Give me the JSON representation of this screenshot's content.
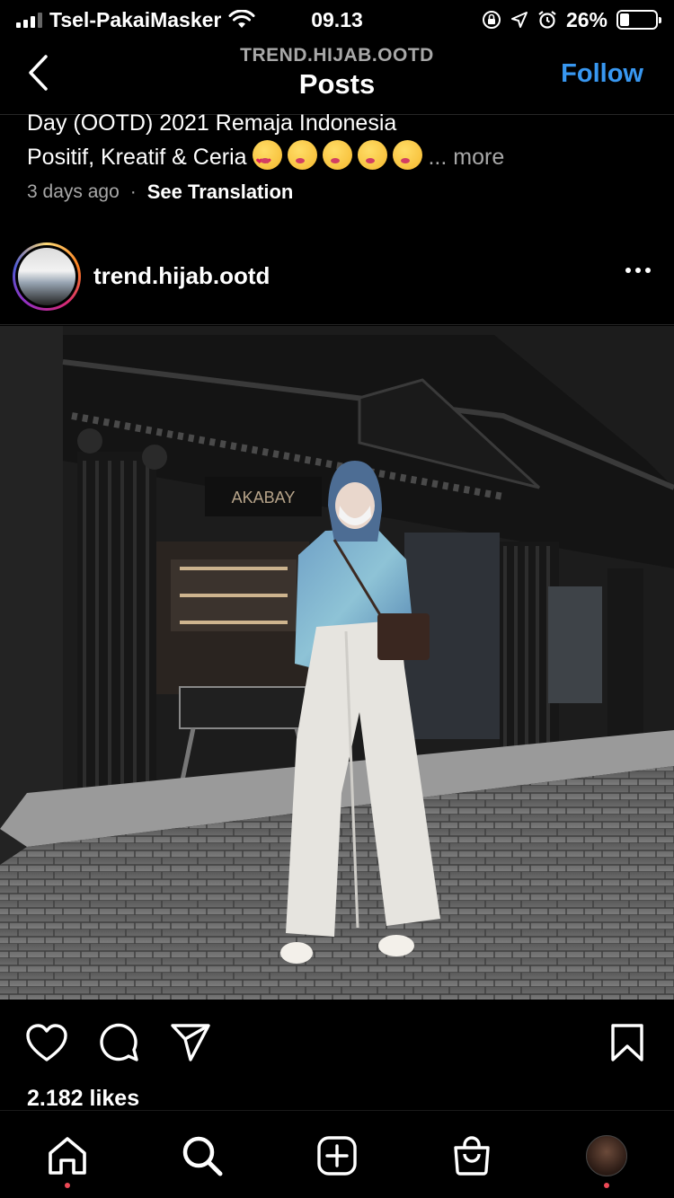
{
  "status_bar": {
    "carrier": "Tsel-PakaiMasker",
    "time": "09.13",
    "battery": "26%",
    "battery_level": 0.26
  },
  "header": {
    "account": "TREND.HIJAB.OOTD",
    "title": "Posts",
    "follow_label": "Follow"
  },
  "caption": {
    "line1": "Day (OOTD) 2021 Remaja Indonesia",
    "line2": "Positif, Kreatif & Ceria",
    "more": "... more",
    "time_ago": "3 days ago",
    "separator": "·",
    "see_translation": "See Translation"
  },
  "post": {
    "username": "trend.hijab.ootd",
    "sign_text": "AKABAY",
    "likes": "2.182 likes"
  },
  "icons": {
    "back": "chevron-left-icon",
    "more": "more-horizontal-icon",
    "like": "heart-icon",
    "comment": "comment-icon",
    "share": "send-icon",
    "save": "bookmark-icon",
    "home": "home-icon",
    "search": "search-icon",
    "create": "plus-square-icon",
    "shop": "shopping-bag-icon"
  },
  "colors": {
    "follow": "#3897f0",
    "notification_dot": "#ed4956",
    "background": "#000000"
  }
}
